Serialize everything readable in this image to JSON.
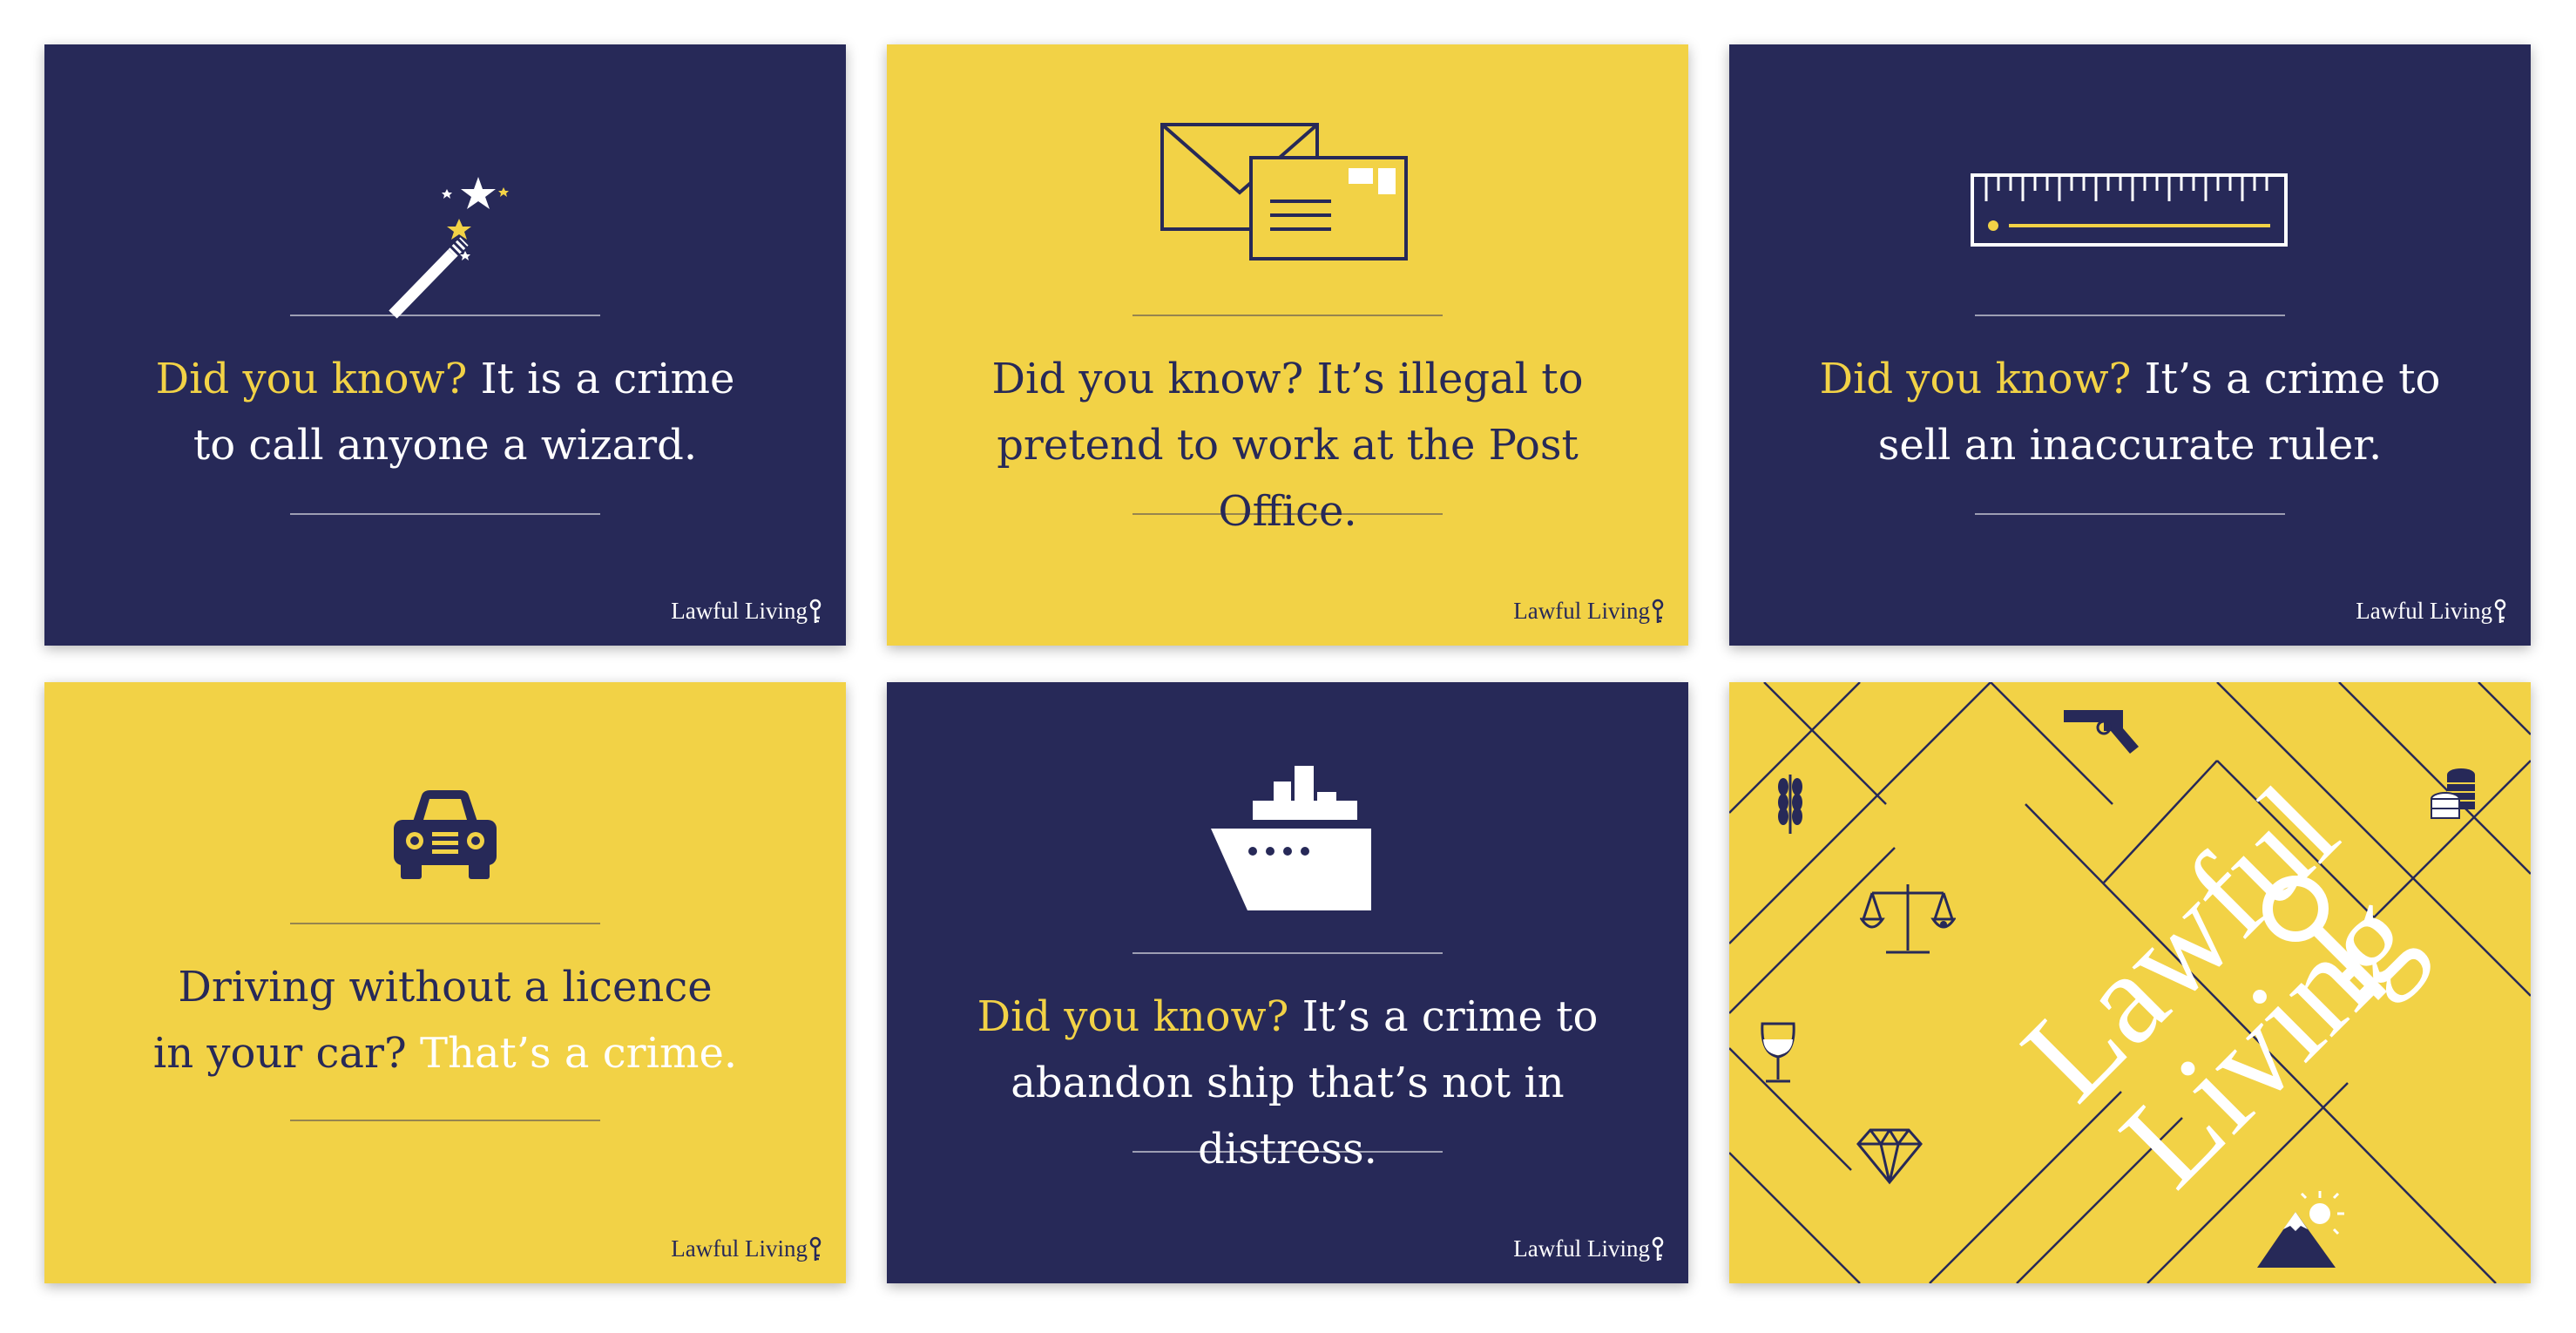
{
  "colors": {
    "navy": "#272958",
    "yellow": "#f2d246",
    "white": "#ffffff"
  },
  "brand": {
    "name": "Lawful Living"
  },
  "cards": [
    {
      "icon": "magic-wand-icon",
      "highlight": "Did you know?",
      "line1_rest": " It is a crime",
      "line2": "to call anyone a wizard."
    },
    {
      "icon": "envelopes-icon",
      "highlight": "Did you know?",
      "line1_rest": " It’s illegal to",
      "line2": "pretend to work at the Post Office."
    },
    {
      "icon": "ruler-icon",
      "highlight": "Did you know?",
      "line1_rest": " It’s a crime to",
      "line2": "sell an inaccurate ruler."
    },
    {
      "icon": "car-icon",
      "line1": "Driving without a licence",
      "line2_start": "in your car? ",
      "highlight": "That’s a crime."
    },
    {
      "icon": "ship-icon",
      "highlight": "Did you know?",
      "line1_rest": " It’s a crime to",
      "line2": "abandon ship that’s not in distress."
    },
    {
      "icons": [
        "wheat-icon",
        "revolver-icon",
        "coins-icon",
        "scales-icon",
        "wine-glass-icon",
        "diamond-icon",
        "mountain-sun-icon",
        "key-icon"
      ],
      "logo_line1": "Lawful",
      "logo_line2": "Living"
    }
  ]
}
